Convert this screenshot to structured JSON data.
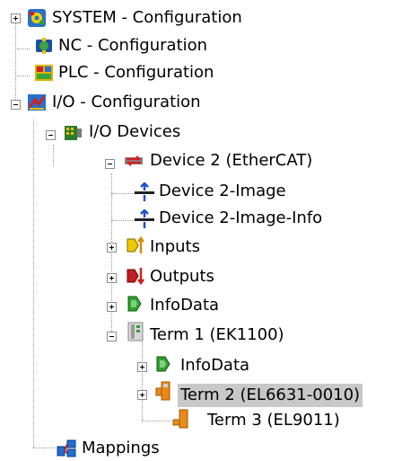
{
  "tree": {
    "system": "SYSTEM - Configuration",
    "nc": "NC - Configuration",
    "plc": "PLC - Configuration",
    "io": "I/O - Configuration",
    "io_devices": "I/O Devices",
    "device2": "Device 2 (EtherCAT)",
    "device2_image": "Device 2-Image",
    "device2_image_info": "Device 2-Image-Info",
    "inputs": "Inputs",
    "outputs": "Outputs",
    "infodata": "InfoData",
    "term1": "Term 1 (EK1100)",
    "term1_infodata": "InfoData",
    "term2": "Term 2 (EL6631-0010)",
    "term3": "Term 3 (EL9011)",
    "mappings": "Mappings"
  },
  "colors": {
    "selection": "#c8c8c8",
    "guide_lines": "#9a9a9a"
  }
}
